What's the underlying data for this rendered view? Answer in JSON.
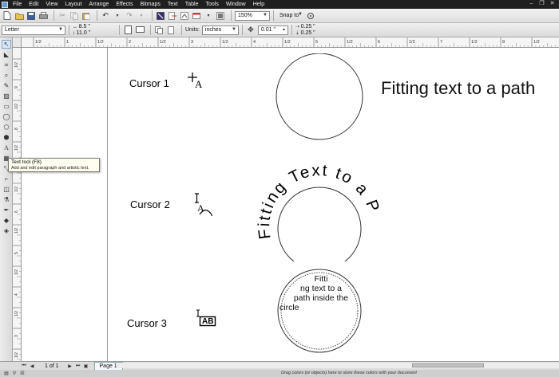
{
  "menubar": {
    "items": [
      "File",
      "Edit",
      "View",
      "Layout",
      "Arrange",
      "Effects",
      "Bitmaps",
      "Text",
      "Table",
      "Tools",
      "Window",
      "Help"
    ]
  },
  "toolbar": {
    "zoom": "150%",
    "snap": "Snap to",
    "page_size": "Letter",
    "width": "8.5 \"",
    "height": "11.0 \"",
    "units_label": "Units:",
    "units_value": "inches",
    "nudge": "0.01 \"",
    "dup_x": "0.25 \"",
    "dup_y": "0.25 \""
  },
  "icons": {
    "new": "new-doc-icon",
    "open": "open-icon",
    "save": "save-icon",
    "print": "print-icon",
    "cut": "cut-icon",
    "copy": "copy-icon",
    "paste": "paste-icon",
    "undo": "undo-icon",
    "redo": "redo-icon"
  },
  "tooltip": {
    "title": "Text tool (F8)",
    "body": "Add and edit paragraph and artistic text."
  },
  "canvas": {
    "heading": "Fitting text to a path",
    "cursor1": "Cursor 1",
    "cursor2": "Cursor 2",
    "cursor3": "Cursor 3",
    "path_text": "Fitting Text to a Path",
    "inner_text": [
      "Fitti",
      "ng text to a",
      "path inside the",
      "circle"
    ],
    "cursor3_glyph": "AB"
  },
  "bottombar": {
    "page_count": "1 of 1",
    "page_tab": "Page 1",
    "status": "Drag colors (or objects) here to store these colors with your document"
  },
  "rulers": {
    "top_labels": [
      "1/2",
      "1",
      "1/2",
      "2",
      "1/2",
      "3",
      "1/2",
      "4",
      "1/2",
      "5",
      "1/2",
      "6",
      "1/2",
      "7",
      "1/2",
      "8",
      "1/2"
    ],
    "left_labels": [
      "1/2",
      "9",
      "1/2",
      "8",
      "1/2",
      "7",
      "1/2",
      "6",
      "1/2",
      "5",
      "1/2",
      "4",
      "1/2",
      "3",
      "1/2"
    ],
    "units": "inches"
  },
  "colors": {
    "menubar_bg": "#1f1f1f",
    "active_tab": "#f4f8fc"
  }
}
